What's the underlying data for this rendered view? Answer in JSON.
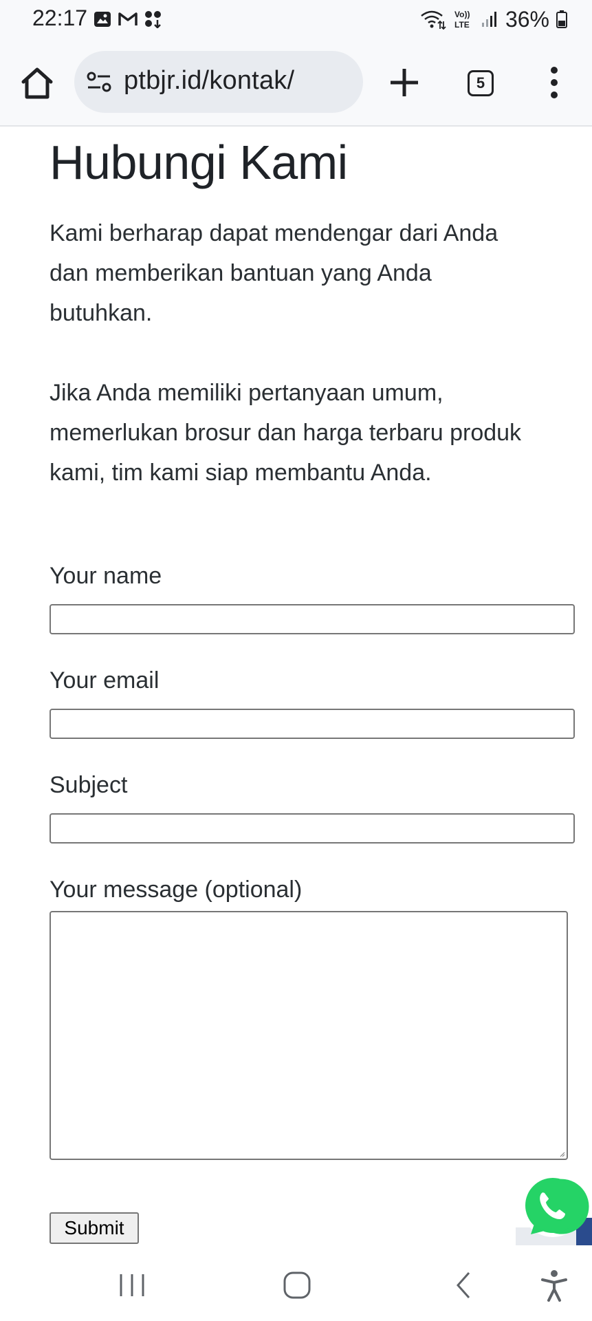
{
  "status_bar": {
    "time": "22:17",
    "left_icons": [
      "gallery-icon",
      "gmail-icon",
      "app-notification-icon"
    ],
    "right_icons": [
      "wifi-icon",
      "volte-icon",
      "signal-icon",
      "battery-icon"
    ],
    "battery_percent": "36%",
    "volte_label": "Vo)) LTE"
  },
  "browser": {
    "url": "ptbjr.id/kontak/",
    "tab_count": "5"
  },
  "page": {
    "title": "Hubungi Kami",
    "intro_1": "Kami berharap dapat mendengar dari Anda dan memberikan bantuan yang Anda butuhkan.",
    "intro_2": "Jika Anda memiliki pertanyaan umum, memerlukan brosur dan harga terbaru produk kami, tim kami siap membantu Anda."
  },
  "form": {
    "name_label": "Your name",
    "name_value": "",
    "email_label": "Your email",
    "email_value": "",
    "subject_label": "Subject",
    "subject_value": "",
    "message_label": "Your message (optional)",
    "message_value": "",
    "submit_label": "Submit"
  },
  "colors": {
    "whatsapp_green": "#25d366",
    "text": "#1f2328",
    "toolbar_bg": "#f8f9fb",
    "urlbar_bg": "#e8ebf0"
  }
}
